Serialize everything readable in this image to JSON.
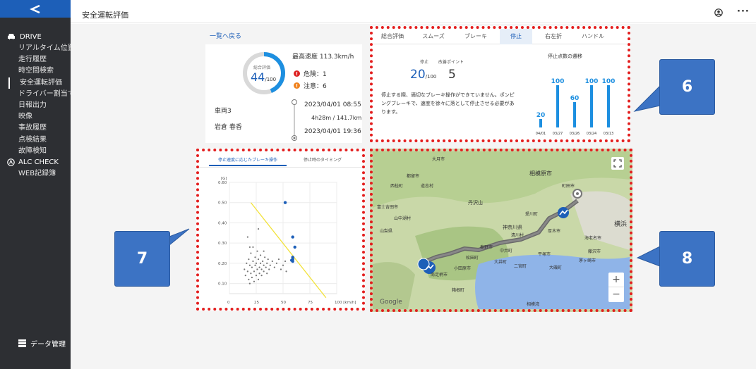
{
  "app": {
    "title": "安全運転評価"
  },
  "sidebar": {
    "drive_label": "DRIVE",
    "items": [
      "リアルタイム位置",
      "走行履歴",
      "時空間検索",
      "安全運転評価",
      "ドライバー割当て",
      "日報出力",
      "映像",
      "事故履歴",
      "点検結果",
      "故障検知"
    ],
    "alc_label": "ALC CHECK",
    "web_label": "WEB記録簿",
    "data_label": "データ管理"
  },
  "summary": {
    "back_link": "一覧へ戻る",
    "ring_caption": "総合評価",
    "score": "44",
    "score_max": "/100",
    "score_value": 44,
    "max_speed": "最高速度 113.3km/h",
    "danger": "危険：1",
    "caution": "注意：6",
    "vehicle": "車両3",
    "driver": "岩倉 春香",
    "start_time": "2023/04/01 08:55",
    "duration": "4h28m / 141.7km",
    "end_time": "2023/04/01 19:36"
  },
  "panel6": {
    "tabs": [
      "総合評価",
      "スムーズ",
      "ブレーキ",
      "停止",
      "右左折",
      "ハンドル"
    ],
    "active_tab": 3,
    "stop_label": "停止",
    "improve_label": "改善ポイント",
    "stop_score": "20",
    "stop_score_max": "/100",
    "improve_points": "5",
    "description": "停止する際、適切なブレーキ操作ができていません。ポンピングブレーキで、速度を徐々に落として停止させる必要があります。",
    "trend_title": "停止点数の遷移"
  },
  "panel7": {
    "tabs": [
      "停止速度に応じたブレーキ操作",
      "停止時のタイミング"
    ],
    "active_tab": 0
  },
  "callouts": {
    "six": "6",
    "seven": "7",
    "eight": "8"
  },
  "map": {
    "labels": [
      "相模原市",
      "町田市",
      "神奈川県",
      "横浜",
      "山梨県",
      "丹沢山",
      "秦野市",
      "平塚市",
      "藤沢市",
      "茅ヶ崎市",
      "小田原市",
      "大井町",
      "二宮町",
      "箱根町",
      "道志村",
      "西桂町",
      "都留市",
      "富士吉田市",
      "山中湖村",
      "大月市",
      "愛川町",
      "厚木市",
      "清川村",
      "海老名市",
      "松田町",
      "相模湾",
      "南足柄市",
      "中井町",
      "大磯町"
    ],
    "google_label": "Google",
    "zoom_in": "+",
    "zoom_out": "−"
  },
  "colors": {
    "accent": "#1d5fb8",
    "callout": "#3c73c4",
    "highlight": "#e31f1f"
  },
  "chart_data": [
    {
      "type": "bar",
      "title": "停止点数の遷移",
      "categories": [
        "04/01",
        "03/27",
        "03/26",
        "03/24",
        "03/13"
      ],
      "values": [
        20,
        100,
        60,
        100,
        100
      ],
      "ylim": [
        0,
        100
      ]
    },
    {
      "type": "scatter",
      "title": "",
      "xlabel": "[km/h]",
      "ylabel": "[G]",
      "xlim": [
        0,
        100
      ],
      "ylim": [
        0.05,
        0.6
      ],
      "xticks": [
        "0",
        "25",
        "50",
        "75",
        "100 [km/h]"
      ],
      "yticks": [
        "0.10",
        "0.20",
        "0.30",
        "0.40",
        "0.50",
        "0.60"
      ],
      "series": [
        {
          "color": "gray",
          "points": [
            [
              14,
              0.17
            ],
            [
              15,
              0.14
            ],
            [
              16,
              0.2
            ],
            [
              17,
              0.16
            ],
            [
              18,
              0.22
            ],
            [
              18,
              0.12
            ],
            [
              19,
              0.19
            ],
            [
              19,
              0.1
            ],
            [
              20,
              0.15
            ],
            [
              20,
              0.25
            ],
            [
              21,
              0.18
            ],
            [
              21,
              0.13
            ],
            [
              22,
              0.21
            ],
            [
              22,
              0.28
            ],
            [
              23,
              0.16
            ],
            [
              23,
              0.11
            ],
            [
              24,
              0.19
            ],
            [
              24,
              0.23
            ],
            [
              25,
              0.14
            ],
            [
              25,
              0.2
            ],
            [
              26,
              0.17
            ],
            [
              26,
              0.26
            ],
            [
              27,
              0.12
            ],
            [
              27,
              0.22
            ],
            [
              28,
              0.18
            ],
            [
              28,
              0.15
            ],
            [
              29,
              0.24
            ],
            [
              29,
              0.2
            ],
            [
              30,
              0.17
            ],
            [
              30,
              0.14
            ],
            [
              31,
              0.21
            ],
            [
              32,
              0.19
            ],
            [
              32,
              0.16
            ],
            [
              33,
              0.23
            ],
            [
              34,
              0.18
            ],
            [
              35,
              0.2
            ],
            [
              35,
              0.15
            ],
            [
              36,
              0.22
            ],
            [
              37,
              0.17
            ],
            [
              38,
              0.19
            ],
            [
              40,
              0.21
            ],
            [
              42,
              0.18
            ],
            [
              44,
              0.2
            ],
            [
              46,
              0.22
            ],
            [
              48,
              0.17
            ],
            [
              50,
              0.19
            ],
            [
              52,
              0.21
            ],
            [
              53,
              0.16
            ],
            [
              17,
              0.33
            ],
            [
              27,
              0.37
            ],
            [
              32,
              0.26
            ],
            [
              19,
              0.28
            ]
          ]
        },
        {
          "color": "blue",
          "points": [
            [
              52,
              0.5
            ],
            [
              59,
              0.33
            ],
            [
              61,
              0.28
            ],
            [
              59,
              0.23
            ],
            [
              59,
              0.22
            ],
            [
              59,
              0.21
            ],
            [
              58,
              0.215
            ]
          ]
        }
      ],
      "trendline": [
        [
          20,
          0.5
        ],
        [
          90,
          0.03
        ]
      ]
    }
  ]
}
